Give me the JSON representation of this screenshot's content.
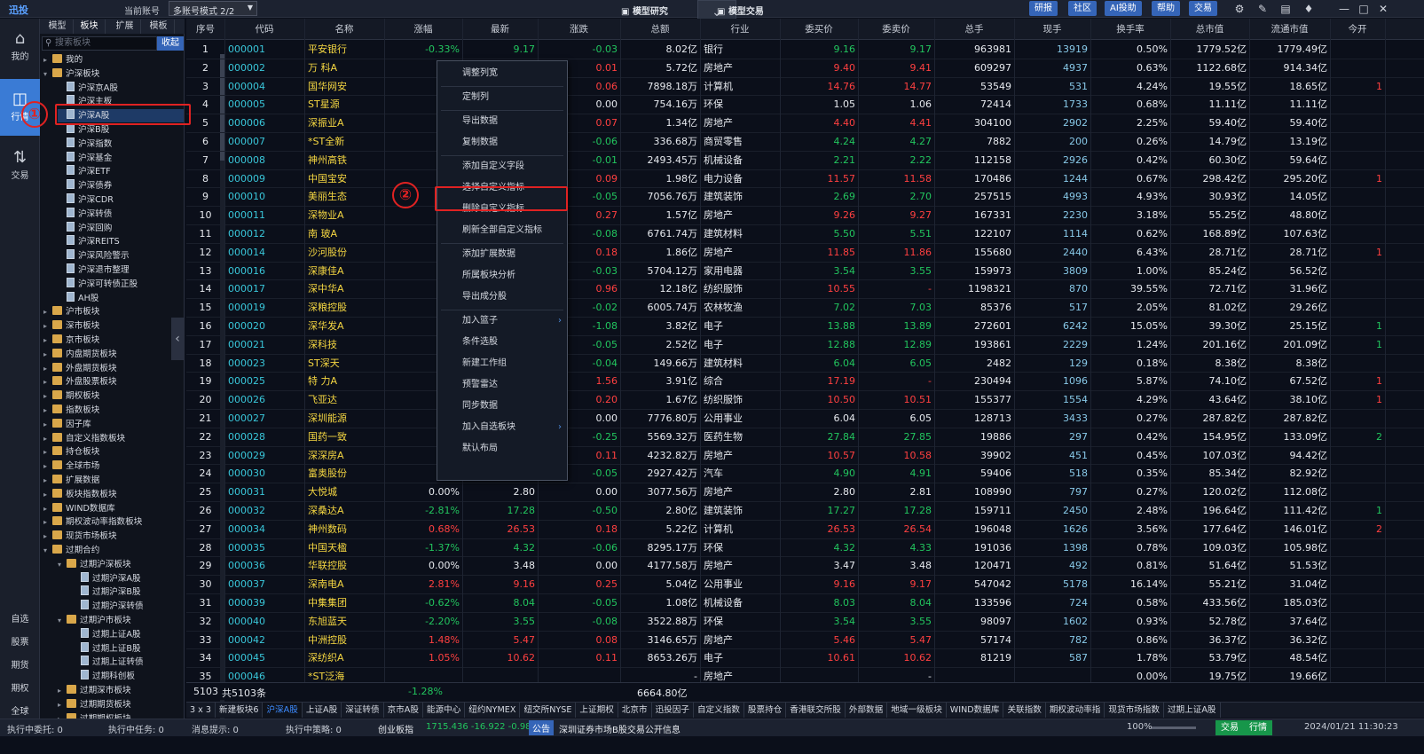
{
  "topbar": {
    "app_name": "迅投",
    "account_label": "当前账号",
    "mode_select": "多账号模式 2/2",
    "center_left": "模型研究",
    "center_right": "模型交易",
    "buttons": [
      "研报",
      "社区",
      "AI投助",
      "帮助",
      "交易"
    ]
  },
  "leftnav": {
    "items": [
      {
        "label": "我的",
        "icon": "home-icon"
      },
      {
        "label": "行情",
        "icon": "chart-icon"
      },
      {
        "label": "交易",
        "icon": "trade-icon"
      }
    ],
    "bottom": [
      "自选",
      "股票",
      "期货",
      "期权",
      "全球"
    ]
  },
  "sidebar": {
    "tabs": [
      "模型",
      "板块",
      "扩展",
      "模板"
    ],
    "search_placeholder": "搜索板块",
    "collapse_label": "收起",
    "tree": [
      {
        "t": "我的",
        "lvl": 0,
        "k": "f",
        "a": "▸"
      },
      {
        "t": "沪深板块",
        "lvl": 0,
        "k": "f",
        "a": "▾"
      },
      {
        "t": "沪深京A股",
        "lvl": 1,
        "k": "d"
      },
      {
        "t": "沪深主板",
        "lvl": 1,
        "k": "d"
      },
      {
        "t": "沪深A股",
        "lvl": 1,
        "k": "d",
        "sel": true
      },
      {
        "t": "沪深B股",
        "lvl": 1,
        "k": "d"
      },
      {
        "t": "沪深指数",
        "lvl": 1,
        "k": "d"
      },
      {
        "t": "沪深基金",
        "lvl": 1,
        "k": "d"
      },
      {
        "t": "沪深ETF",
        "lvl": 1,
        "k": "d"
      },
      {
        "t": "沪深债券",
        "lvl": 1,
        "k": "d"
      },
      {
        "t": "沪深CDR",
        "lvl": 1,
        "k": "d"
      },
      {
        "t": "沪深转债",
        "lvl": 1,
        "k": "d"
      },
      {
        "t": "沪深回购",
        "lvl": 1,
        "k": "d"
      },
      {
        "t": "沪深REITS",
        "lvl": 1,
        "k": "d"
      },
      {
        "t": "沪深风险警示",
        "lvl": 1,
        "k": "d"
      },
      {
        "t": "沪深退市整理",
        "lvl": 1,
        "k": "d"
      },
      {
        "t": "沪深可转债正股",
        "lvl": 1,
        "k": "d"
      },
      {
        "t": "AH股",
        "lvl": 1,
        "k": "d"
      },
      {
        "t": "沪市板块",
        "lvl": 0,
        "k": "f",
        "a": "▸"
      },
      {
        "t": "深市板块",
        "lvl": 0,
        "k": "f",
        "a": "▸"
      },
      {
        "t": "京市板块",
        "lvl": 0,
        "k": "f",
        "a": "▸"
      },
      {
        "t": "内盘期货板块",
        "lvl": 0,
        "k": "f",
        "a": "▸"
      },
      {
        "t": "外盘期货板块",
        "lvl": 0,
        "k": "f",
        "a": "▸"
      },
      {
        "t": "外盘股票板块",
        "lvl": 0,
        "k": "f",
        "a": "▸"
      },
      {
        "t": "期权板块",
        "lvl": 0,
        "k": "f",
        "a": "▸"
      },
      {
        "t": "指数板块",
        "lvl": 0,
        "k": "f",
        "a": "▸"
      },
      {
        "t": "因子库",
        "lvl": 0,
        "k": "f",
        "a": "▸"
      },
      {
        "t": "自定义指数板块",
        "lvl": 0,
        "k": "f",
        "a": "▸"
      },
      {
        "t": "持仓板块",
        "lvl": 0,
        "k": "f",
        "a": "▸"
      },
      {
        "t": "全球市场",
        "lvl": 0,
        "k": "f",
        "a": "▸"
      },
      {
        "t": "扩展数据",
        "lvl": 0,
        "k": "f",
        "a": "▸"
      },
      {
        "t": "板块指数板块",
        "lvl": 0,
        "k": "f",
        "a": "▸"
      },
      {
        "t": "WIND数据库",
        "lvl": 0,
        "k": "f",
        "a": "▸"
      },
      {
        "t": "期权波动率指数板块",
        "lvl": 0,
        "k": "f",
        "a": "▸"
      },
      {
        "t": "现货市场板块",
        "lvl": 0,
        "k": "f",
        "a": "▸"
      },
      {
        "t": "过期合约",
        "lvl": 0,
        "k": "f",
        "a": "▾"
      },
      {
        "t": "过期沪深板块",
        "lvl": 1,
        "k": "f",
        "a": "▾"
      },
      {
        "t": "过期沪深A股",
        "lvl": 2,
        "k": "d"
      },
      {
        "t": "过期沪深B股",
        "lvl": 2,
        "k": "d"
      },
      {
        "t": "过期沪深转债",
        "lvl": 2,
        "k": "d"
      },
      {
        "t": "过期沪市板块",
        "lvl": 1,
        "k": "f",
        "a": "▾"
      },
      {
        "t": "过期上证A股",
        "lvl": 2,
        "k": "d"
      },
      {
        "t": "过期上证B股",
        "lvl": 2,
        "k": "d"
      },
      {
        "t": "过期上证转债",
        "lvl": 2,
        "k": "d"
      },
      {
        "t": "过期科创板",
        "lvl": 2,
        "k": "d"
      },
      {
        "t": "过期深市板块",
        "lvl": 1,
        "k": "f",
        "a": "▸"
      },
      {
        "t": "过期期货板块",
        "lvl": 1,
        "k": "f",
        "a": "▸"
      },
      {
        "t": "过期期权板块",
        "lvl": 1,
        "k": "f",
        "a": "▸"
      }
    ]
  },
  "table": {
    "headers": [
      "序号",
      "代码",
      "名称",
      "涨幅",
      "最新",
      "涨跌",
      "总额",
      "行业",
      "委买价",
      "委卖价",
      "总手",
      "现手",
      "换手率",
      "总市值",
      "流通市值",
      "今开"
    ],
    "rows": [
      [
        "1",
        "000001",
        "平安银行",
        "-0.33%",
        "9.17",
        "-0.03",
        "8.02亿",
        "银行",
        "9.16",
        "9.17",
        "963981",
        "13919",
        "0.50%",
        "1779.52亿",
        "1779.49亿",
        ""
      ],
      [
        "2",
        "000002",
        "万 科A",
        "",
        "",
        "0.01",
        "5.72亿",
        "房地产",
        "9.40",
        "9.41",
        "609297",
        "4937",
        "0.63%",
        "1122.68亿",
        "914.34亿",
        ""
      ],
      [
        "3",
        "000004",
        "国华网安",
        "",
        "",
        "0.06",
        "7898.18万",
        "计算机",
        "14.76",
        "14.77",
        "53549",
        "531",
        "4.24%",
        "19.55亿",
        "18.65亿",
        "1"
      ],
      [
        "4",
        "000005",
        "ST星源",
        "",
        "",
        "0.00",
        "754.16万",
        "环保",
        "1.05",
        "1.06",
        "72414",
        "1733",
        "0.68%",
        "11.11亿",
        "11.11亿",
        ""
      ],
      [
        "5",
        "000006",
        "深振业A",
        "1.",
        "",
        "0.07",
        "1.34亿",
        "房地产",
        "4.40",
        "4.41",
        "304100",
        "2902",
        "2.25%",
        "59.40亿",
        "59.40亿",
        ""
      ],
      [
        "6",
        "000007",
        "*ST全新",
        "-1.",
        "",
        "-0.06",
        "336.68万",
        "商贸零售",
        "4.24",
        "4.27",
        "7882",
        "200",
        "0.26%",
        "14.79亿",
        "13.19亿",
        ""
      ],
      [
        "7",
        "000008",
        "神州高铁",
        "-0.",
        "",
        "-0.01",
        "2493.45万",
        "机械设备",
        "2.21",
        "2.22",
        "112158",
        "2926",
        "0.42%",
        "60.30亿",
        "59.64亿",
        ""
      ],
      [
        "8",
        "000009",
        "中国宝安",
        "0.",
        "",
        "0.09",
        "1.98亿",
        "电力设备",
        "11.57",
        "11.58",
        "170486",
        "1244",
        "0.67%",
        "298.42亿",
        "295.20亿",
        "1"
      ],
      [
        "9",
        "000010",
        "美丽生态",
        "-1.",
        "",
        "-0.05",
        "7056.76万",
        "建筑装饰",
        "2.69",
        "2.70",
        "257515",
        "4993",
        "4.93%",
        "30.93亿",
        "14.05亿",
        ""
      ],
      [
        "10",
        "000011",
        "深物业A",
        "3.",
        "",
        "0.27",
        "1.57亿",
        "房地产",
        "9.26",
        "9.27",
        "167331",
        "2230",
        "3.18%",
        "55.25亿",
        "48.80亿",
        ""
      ],
      [
        "11",
        "000012",
        "南 玻A",
        "-0.",
        "",
        "-0.08",
        "6761.74万",
        "建筑材料",
        "5.50",
        "5.51",
        "122107",
        "1114",
        "0.62%",
        "168.89亿",
        "107.63亿",
        ""
      ],
      [
        "12",
        "000014",
        "沙河股份",
        "0.",
        "",
        "0.18",
        "1.86亿",
        "房地产",
        "11.85",
        "11.86",
        "155680",
        "2440",
        "6.43%",
        "28.71亿",
        "28.71亿",
        "1"
      ],
      [
        "13",
        "000016",
        "深康佳A",
        "-0.",
        "",
        "-0.03",
        "5704.12万",
        "家用电器",
        "3.54",
        "3.55",
        "159973",
        "3809",
        "1.00%",
        "85.24亿",
        "56.52亿",
        ""
      ],
      [
        "14",
        "000017",
        "深中华A",
        "10.",
        "",
        "0.96",
        "12.18亿",
        "纺织服饰",
        "10.55",
        "-",
        "1198321",
        "870",
        "39.55%",
        "72.71亿",
        "31.96亿",
        ""
      ],
      [
        "15",
        "000019",
        "深粮控股",
        "-0.",
        "",
        "-0.02",
        "6005.74万",
        "农林牧渔",
        "7.02",
        "7.03",
        "85376",
        "517",
        "2.05%",
        "81.02亿",
        "29.26亿",
        ""
      ],
      [
        "16",
        "000020",
        "深华发A",
        "-7.",
        "",
        "-1.08",
        "3.82亿",
        "电子",
        "13.88",
        "13.89",
        "272601",
        "6242",
        "15.05%",
        "39.30亿",
        "25.15亿",
        "1"
      ],
      [
        "17",
        "000021",
        "深科技",
        "-0.",
        "",
        "-0.05",
        "2.52亿",
        "电子",
        "12.88",
        "12.89",
        "193861",
        "2229",
        "1.24%",
        "201.16亿",
        "201.09亿",
        "1"
      ],
      [
        "18",
        "000023",
        "ST深天",
        "-0.",
        "",
        "-0.04",
        "149.66万",
        "建筑材料",
        "6.04",
        "6.05",
        "2482",
        "129",
        "0.18%",
        "8.38亿",
        "8.38亿",
        ""
      ],
      [
        "19",
        "000025",
        "特 力A",
        "9.",
        "",
        "1.56",
        "3.91亿",
        "综合",
        "17.19",
        "-",
        "230494",
        "1096",
        "5.87%",
        "74.10亿",
        "67.52亿",
        "1"
      ],
      [
        "20",
        "000026",
        "飞亚达",
        "2.",
        "",
        "0.20",
        "1.67亿",
        "纺织服饰",
        "10.50",
        "10.51",
        "155377",
        "1554",
        "4.29%",
        "43.64亿",
        "38.10亿",
        "1"
      ],
      [
        "21",
        "000027",
        "深圳能源",
        "0.",
        "",
        "0.00",
        "7776.80万",
        "公用事业",
        "6.04",
        "6.05",
        "128713",
        "3433",
        "0.27%",
        "287.82亿",
        "287.82亿",
        ""
      ],
      [
        "22",
        "000028",
        "国药一致",
        "-0.",
        "",
        "-0.25",
        "5569.32万",
        "医药生物",
        "27.84",
        "27.85",
        "19886",
        "297",
        "0.42%",
        "154.95亿",
        "133.09亿",
        "2"
      ],
      [
        "23",
        "000029",
        "深深房A",
        "1.",
        "",
        "0.11",
        "4232.82万",
        "房地产",
        "10.57",
        "10.58",
        "39902",
        "451",
        "0.45%",
        "107.03亿",
        "94.42亿",
        ""
      ],
      [
        "24",
        "000030",
        "富奥股份",
        "-0.",
        "",
        "-0.05",
        "2927.42万",
        "汽车",
        "4.90",
        "4.91",
        "59406",
        "518",
        "0.35%",
        "85.34亿",
        "82.92亿",
        ""
      ],
      [
        "25",
        "000031",
        "大悦城",
        "0.00%",
        "2.80",
        "0.00",
        "3077.56万",
        "房地产",
        "2.80",
        "2.81",
        "108990",
        "797",
        "0.27%",
        "120.02亿",
        "112.08亿",
        ""
      ],
      [
        "26",
        "000032",
        "深桑达A",
        "-2.81%",
        "17.28",
        "-0.50",
        "2.80亿",
        "建筑装饰",
        "17.27",
        "17.28",
        "159711",
        "2450",
        "2.48%",
        "196.64亿",
        "111.42亿",
        "1"
      ],
      [
        "27",
        "000034",
        "神州数码",
        "0.68%",
        "26.53",
        "0.18",
        "5.22亿",
        "计算机",
        "26.53",
        "26.54",
        "196048",
        "1626",
        "3.56%",
        "177.64亿",
        "146.01亿",
        "2"
      ],
      [
        "28",
        "000035",
        "中国天楹",
        "-1.37%",
        "4.32",
        "-0.06",
        "8295.17万",
        "环保",
        "4.32",
        "4.33",
        "191036",
        "1398",
        "0.78%",
        "109.03亿",
        "105.98亿",
        ""
      ],
      [
        "29",
        "000036",
        "华联控股",
        "0.00%",
        "3.48",
        "0.00",
        "4177.58万",
        "房地产",
        "3.47",
        "3.48",
        "120471",
        "492",
        "0.81%",
        "51.64亿",
        "51.53亿",
        ""
      ],
      [
        "30",
        "000037",
        "深南电A",
        "2.81%",
        "9.16",
        "0.25",
        "5.04亿",
        "公用事业",
        "9.16",
        "9.17",
        "547042",
        "5178",
        "16.14%",
        "55.21亿",
        "31.04亿",
        ""
      ],
      [
        "31",
        "000039",
        "中集集团",
        "-0.62%",
        "8.04",
        "-0.05",
        "1.08亿",
        "机械设备",
        "8.03",
        "8.04",
        "133596",
        "724",
        "0.58%",
        "433.56亿",
        "185.03亿",
        ""
      ],
      [
        "32",
        "000040",
        "东旭蓝天",
        "-2.20%",
        "3.55",
        "-0.08",
        "3522.88万",
        "环保",
        "3.54",
        "3.55",
        "98097",
        "1602",
        "0.93%",
        "52.78亿",
        "37.64亿",
        ""
      ],
      [
        "33",
        "000042",
        "中洲控股",
        "1.48%",
        "5.47",
        "0.08",
        "3146.65万",
        "房地产",
        "5.46",
        "5.47",
        "57174",
        "782",
        "0.86%",
        "36.37亿",
        "36.32亿",
        ""
      ],
      [
        "34",
        "000045",
        "深纺织A",
        "1.05%",
        "10.62",
        "0.11",
        "8653.26万",
        "电子",
        "10.61",
        "10.62",
        "81219",
        "587",
        "1.78%",
        "53.79亿",
        "48.54亿",
        ""
      ],
      [
        "35",
        "000046",
        "*ST泛海",
        "",
        "",
        "",
        "-",
        "房地产",
        "",
        "-",
        "",
        "",
        "0.00%",
        "19.75亿",
        "19.66亿",
        ""
      ]
    ],
    "vis_row2_vals": {
      "r1_latest": "9.17"
    }
  },
  "footer": {
    "count": "5103",
    "count_label": "共5103条",
    "avg_change": "-1.28%",
    "total_amount": "6664.80亿"
  },
  "bottom_tabs": [
    "3 x 3",
    "新建板块6",
    "沪深A股",
    "上证A股",
    "深证转债",
    "京市A股",
    "能源中心",
    "纽约NYMEX",
    "纽交所NYSE",
    "上证期权",
    "北京市",
    "迅投因子",
    "自定义指数",
    "股票持仓",
    "香港联交所股",
    "外部数据",
    "地域一级板块",
    "WIND数据库",
    "关联指数",
    "期权波动率指",
    "现货市场指数",
    "过期上证A股"
  ],
  "statusbar": {
    "exec_entrust": "执行中委托: 0",
    "exec_task": "执行中任务: 0",
    "msg": "消息提示: 0",
    "exec_strategy": "执行中策略: 0",
    "ticker": "创业板指",
    "ticker_val": "1715.436  -16.922  -0.98%",
    "notice_label": "公告",
    "notice": "深圳证券市场B股交易公开信息",
    "zoom": "100%",
    "btn_trade": "交易",
    "btn_quote": "行情",
    "datetime": "2024/01/21 11:30:23"
  },
  "context_menu": {
    "items": [
      {
        "label": "调整列宽"
      },
      {
        "sep": true
      },
      {
        "label": "定制列"
      },
      {
        "sep": true
      },
      {
        "label": "导出数据"
      },
      {
        "label": "复制数据"
      },
      {
        "sep": true
      },
      {
        "label": "添加自定义字段"
      },
      {
        "label": "选择自定义指标"
      },
      {
        "label": "删除自定义指标"
      },
      {
        "label": "刷新全部自定义指标"
      },
      {
        "sep": true
      },
      {
        "label": "添加扩展数据"
      },
      {
        "label": "所属板块分析"
      },
      {
        "label": "导出成分股"
      },
      {
        "sep": true
      },
      {
        "label": "加入篮子",
        "sub": true
      },
      {
        "label": "条件选股"
      },
      {
        "label": "新建工作组"
      },
      {
        "label": "预警雷达"
      },
      {
        "label": "同步数据"
      },
      {
        "label": "加入自选板块",
        "sub": true
      },
      {
        "label": "默认布局"
      }
    ]
  },
  "annotations": {
    "marker1": "①",
    "marker2": "②"
  },
  "colors": {
    "up": "#ff4040",
    "down": "#22c55e",
    "accent": "#3a7bd5",
    "name_yellow": "#f5d742",
    "code_cyan": "#39c6d9",
    "annotation_red": "#e02222"
  }
}
